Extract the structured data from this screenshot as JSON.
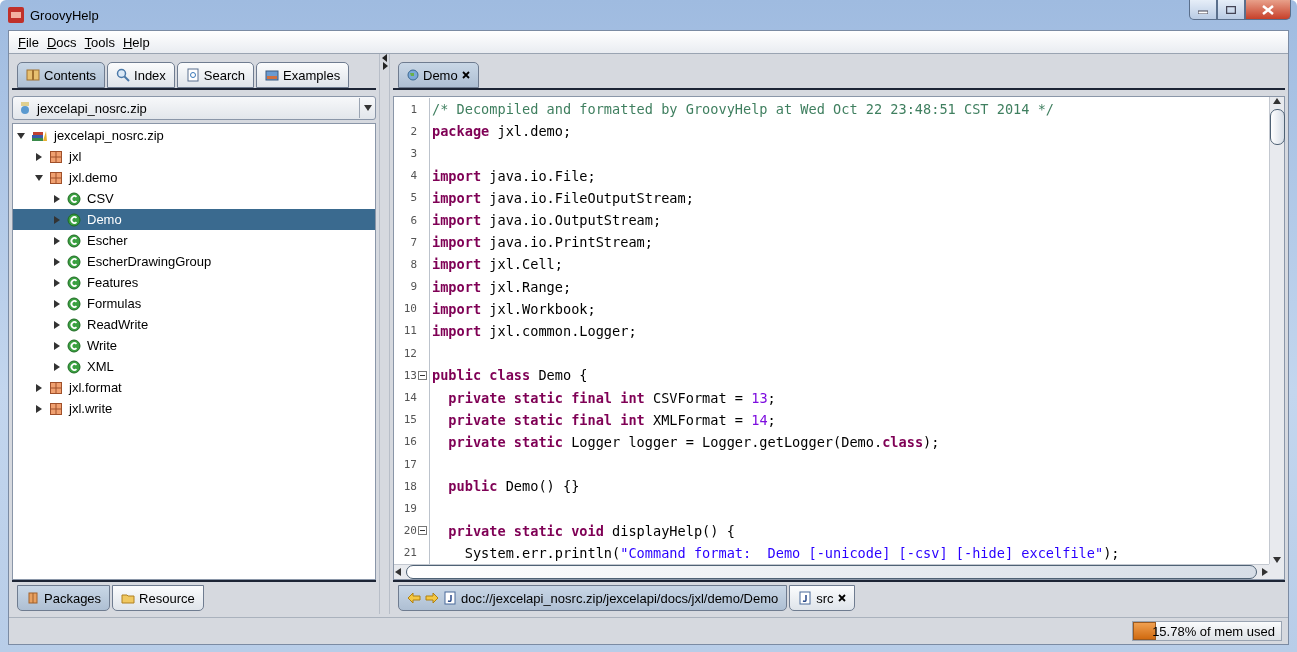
{
  "window": {
    "title": "GroovyHelp"
  },
  "menu": [
    {
      "label": "File"
    },
    {
      "label": "Docs"
    },
    {
      "label": "Tools"
    },
    {
      "label": "Help"
    }
  ],
  "left_tabs": [
    {
      "label": "Contents",
      "kind": "book",
      "selected": true
    },
    {
      "label": "Index",
      "kind": "magnifier",
      "selected": false
    },
    {
      "label": "Search",
      "kind": "document",
      "selected": false
    },
    {
      "label": "Examples",
      "kind": "picture",
      "selected": false
    }
  ],
  "archive_select": {
    "value": "jexcelapi_nosrc.zip"
  },
  "tree": [
    {
      "label": "jexcelapi_nosrc.zip",
      "kind": "archive",
      "expanded": true,
      "selected": false,
      "children": [
        {
          "label": "jxl",
          "kind": "package",
          "expanded": false,
          "selected": false
        },
        {
          "label": "jxl.demo",
          "kind": "package",
          "expanded": true,
          "selected": false,
          "children": [
            {
              "label": "CSV",
              "kind": "class",
              "expanded": false,
              "selected": false
            },
            {
              "label": "Demo",
              "kind": "class",
              "expanded": false,
              "selected": true
            },
            {
              "label": "Escher",
              "kind": "class",
              "expanded": false,
              "selected": false
            },
            {
              "label": "EscherDrawingGroup",
              "kind": "class",
              "expanded": false,
              "selected": false
            },
            {
              "label": "Features",
              "kind": "class",
              "expanded": false,
              "selected": false
            },
            {
              "label": "Formulas",
              "kind": "class",
              "expanded": false,
              "selected": false
            },
            {
              "label": "ReadWrite",
              "kind": "class",
              "expanded": false,
              "selected": false
            },
            {
              "label": "Write",
              "kind": "class",
              "expanded": false,
              "selected": false
            },
            {
              "label": "XML",
              "kind": "class",
              "expanded": false,
              "selected": false
            }
          ]
        },
        {
          "label": "jxl.format",
          "kind": "package",
          "expanded": false,
          "selected": false
        },
        {
          "label": "jxl.write",
          "kind": "package",
          "expanded": false,
          "selected": false
        }
      ]
    }
  ],
  "bottom_left_tabs": [
    {
      "label": "Packages",
      "kind": "packages",
      "selected": true
    },
    {
      "label": "Resource",
      "kind": "folder",
      "selected": false
    }
  ],
  "editor_tabs": [
    {
      "label": "Demo",
      "selected": true
    }
  ],
  "code_lines": [
    {
      "number": "1",
      "fold": false,
      "tokens": [
        {
          "kind": "comment",
          "text": "/* Decompiled and formatted by GroovyHelp at Wed Oct 22 23:48:51 CST 2014 */"
        }
      ]
    },
    {
      "number": "2",
      "fold": false,
      "tokens": [
        {
          "kind": "keyword",
          "text": "package"
        },
        {
          "kind": "plain",
          "text": " jxl.demo;"
        }
      ]
    },
    {
      "number": "3",
      "fold": false
    },
    {
      "number": "4",
      "fold": false,
      "tokens": [
        {
          "kind": "keyword",
          "text": "import"
        },
        {
          "kind": "plain",
          "text": " java.io.File;"
        }
      ]
    },
    {
      "number": "5",
      "fold": false,
      "tokens": [
        {
          "kind": "keyword",
          "text": "import"
        },
        {
          "kind": "plain",
          "text": " java.io.FileOutputStream;"
        }
      ]
    },
    {
      "number": "6",
      "fold": false,
      "tokens": [
        {
          "kind": "keyword",
          "text": "import"
        },
        {
          "kind": "plain",
          "text": " java.io.OutputStream;"
        }
      ]
    },
    {
      "number": "7",
      "fold": false,
      "tokens": [
        {
          "kind": "keyword",
          "text": "import"
        },
        {
          "kind": "plain",
          "text": " java.io.PrintStream;"
        }
      ]
    },
    {
      "number": "8",
      "fold": false,
      "tokens": [
        {
          "kind": "keyword",
          "text": "import"
        },
        {
          "kind": "plain",
          "text": " jxl.Cell;"
        }
      ]
    },
    {
      "number": "9",
      "fold": false,
      "tokens": [
        {
          "kind": "keyword",
          "text": "import"
        },
        {
          "kind": "plain",
          "text": " jxl.Range;"
        }
      ]
    },
    {
      "number": "10",
      "fold": false,
      "tokens": [
        {
          "kind": "keyword",
          "text": "import"
        },
        {
          "kind": "plain",
          "text": " jxl.Workbook;"
        }
      ]
    },
    {
      "number": "11",
      "fold": false,
      "tokens": [
        {
          "kind": "keyword",
          "text": "import"
        },
        {
          "kind": "plain",
          "text": " jxl.common.Logger;"
        }
      ]
    },
    {
      "number": "12",
      "fold": false
    },
    {
      "number": "13",
      "fold": true,
      "tokens": [
        {
          "kind": "keyword",
          "text": "public class"
        },
        {
          "kind": "plain",
          "text": " Demo {"
        }
      ]
    },
    {
      "number": "14",
      "fold": false,
      "tokens": [
        {
          "kind": "keyword",
          "text": "  private static final int"
        },
        {
          "kind": "plain",
          "text": " CSVFormat = "
        },
        {
          "kind": "number",
          "text": "13"
        },
        {
          "kind": "plain",
          "text": ";"
        }
      ]
    },
    {
      "number": "15",
      "fold": false,
      "tokens": [
        {
          "kind": "keyword",
          "text": "  private static final int"
        },
        {
          "kind": "plain",
          "text": " XMLFormat = "
        },
        {
          "kind": "number",
          "text": "14"
        },
        {
          "kind": "plain",
          "text": ";"
        }
      ]
    },
    {
      "number": "16",
      "fold": false,
      "tokens": [
        {
          "kind": "keyword",
          "text": "  private static"
        },
        {
          "kind": "plain",
          "text": " Logger logger = Logger.getLogger(Demo."
        },
        {
          "kind": "keyword",
          "text": "class"
        },
        {
          "kind": "plain",
          "text": ");"
        }
      ]
    },
    {
      "number": "17",
      "fold": false
    },
    {
      "number": "18",
      "fold": false,
      "tokens": [
        {
          "kind": "keyword",
          "text": "  public"
        },
        {
          "kind": "plain",
          "text": " Demo() {}"
        }
      ]
    },
    {
      "number": "19",
      "fold": false
    },
    {
      "number": "20",
      "fold": true,
      "tokens": [
        {
          "kind": "keyword",
          "text": "  private static void"
        },
        {
          "kind": "plain",
          "text": " displayHelp() {"
        }
      ]
    },
    {
      "number": "21",
      "fold": false,
      "tokens": [
        {
          "kind": "plain",
          "text": "    System.err.println("
        },
        {
          "kind": "string",
          "text": "\"Command format:  Demo [-unicode] [-csv] [-hide] excelfile\""
        },
        {
          "kind": "plain",
          "text": ");"
        }
      ]
    }
  ],
  "bottom_right_tabs": [
    {
      "label": "doc://jexcelapi_nosrc.zip/jexcelapi/docs/jxl/demo/Demo",
      "kind": "history",
      "selected": true
    },
    {
      "label": "src",
      "kind": "file",
      "selected": false
    }
  ],
  "memory": {
    "level": 0.1578,
    "reading": "15.78% of mem used"
  }
}
